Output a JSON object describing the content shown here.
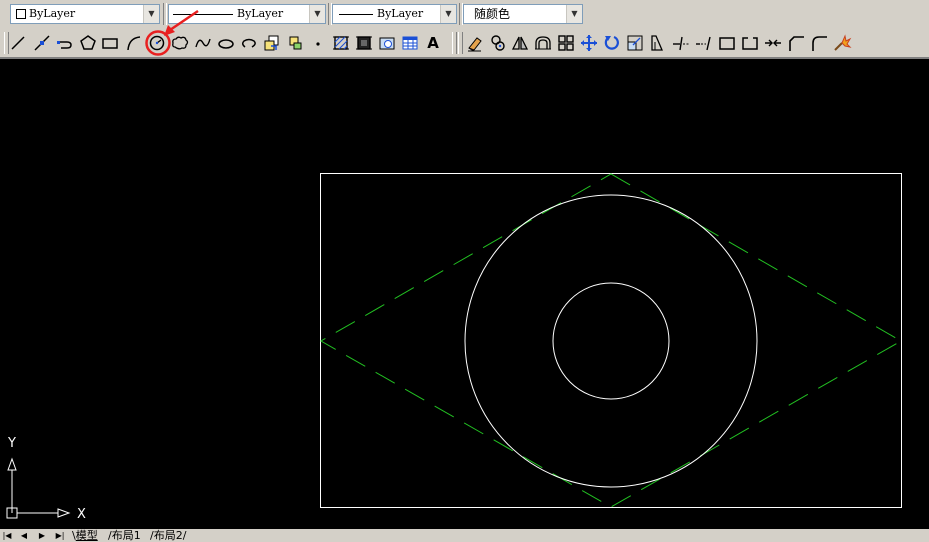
{
  "properties": {
    "layer_control": "ByLayer",
    "linetype_control": "ByLayer",
    "lineweight_control": "ByLayer",
    "color_control": "随颜色"
  },
  "draw_toolbar": {
    "tools": [
      "line",
      "construction-line",
      "polyline",
      "polygon",
      "rectangle",
      "arc",
      "circle",
      "revision-cloud",
      "spline",
      "ellipse",
      "ellipse-arc",
      "insert-block",
      "make-block",
      "point",
      "hatch",
      "gradient",
      "region",
      "table",
      "multiline-text"
    ],
    "text_tool_label": "A",
    "highlighted_tool": "circle",
    "highlight_color": "#e82020"
  },
  "modify_toolbar": {
    "tools": [
      "erase",
      "copy",
      "mirror",
      "offset",
      "array",
      "move",
      "rotate",
      "scale",
      "stretch",
      "trim",
      "extend",
      "break-at-point",
      "break",
      "join",
      "chamfer",
      "fillet",
      "explode"
    ]
  },
  "ucs_icon": {
    "x_label": "X",
    "y_label": "Y"
  },
  "layout_tabs": [
    "模型",
    "布局1",
    "布局2"
  ],
  "active_tab": "模型",
  "colors": {
    "canvas": "#000000",
    "geometry": "#ffffff",
    "construction_lines": "#22c022",
    "toolbar": "#d4d0c8"
  }
}
